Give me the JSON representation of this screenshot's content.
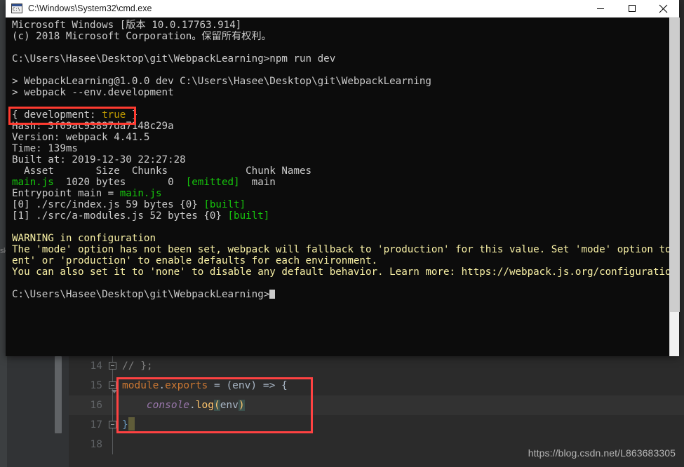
{
  "window": {
    "title": "C:\\Windows\\System32\\cmd.exe",
    "icon_name": "cmd-icon",
    "icon_text": "C:\\",
    "minimize_label": "Minimize",
    "maximize_label": "Maximize",
    "close_label": "Close"
  },
  "console": {
    "lines": [
      {
        "segments": [
          {
            "text": "Microsoft Windows [版本 10.0.17763.914]",
            "color": "white"
          }
        ]
      },
      {
        "segments": [
          {
            "text": "(c) 2018 Microsoft Corporation。保留所有权利。",
            "color": "white"
          }
        ]
      },
      {
        "segments": [
          {
            "text": "",
            "color": "white"
          }
        ]
      },
      {
        "segments": [
          {
            "text": "C:\\Users\\Hasee\\Desktop\\git\\WebpackLearning>npm run dev",
            "color": "white"
          }
        ]
      },
      {
        "segments": [
          {
            "text": "",
            "color": "white"
          }
        ]
      },
      {
        "segments": [
          {
            "text": "> WebpackLearning@1.0.0 dev C:\\Users\\Hasee\\Desktop\\git\\WebpackLearning",
            "color": "white"
          }
        ]
      },
      {
        "segments": [
          {
            "text": "> webpack --env.development",
            "color": "white"
          }
        ]
      },
      {
        "segments": [
          {
            "text": "",
            "color": "white"
          }
        ]
      },
      {
        "segments": [
          {
            "text": "{ development: ",
            "color": "white"
          },
          {
            "text": "true",
            "color": "yellow"
          },
          {
            "text": " }",
            "color": "white"
          }
        ]
      },
      {
        "segments": [
          {
            "text": "Hash: 3f09ac93897da7148c29a",
            "color": "white"
          }
        ]
      },
      {
        "segments": [
          {
            "text": "Version: webpack 4.41.5",
            "color": "white"
          }
        ]
      },
      {
        "segments": [
          {
            "text": "Time: 139ms",
            "color": "white"
          }
        ]
      },
      {
        "segments": [
          {
            "text": "Built at: 2019-12-30 22:27:28",
            "color": "white"
          }
        ]
      },
      {
        "segments": [
          {
            "text": "  Asset       Size  Chunks             Chunk Names",
            "color": "white"
          }
        ]
      },
      {
        "segments": [
          {
            "text": "main.js",
            "color": "green"
          },
          {
            "text": "  1020 bytes       0  ",
            "color": "white"
          },
          {
            "text": "[emitted]",
            "color": "green"
          },
          {
            "text": "  main",
            "color": "white"
          }
        ]
      },
      {
        "segments": [
          {
            "text": "Entrypoint main = ",
            "color": "white"
          },
          {
            "text": "main.js",
            "color": "green"
          }
        ]
      },
      {
        "segments": [
          {
            "text": "[0] ./src/index.js 59 bytes {0} ",
            "color": "white"
          },
          {
            "text": "[built]",
            "color": "green"
          }
        ]
      },
      {
        "segments": [
          {
            "text": "[1] ./src/a-modules.js 52 bytes {0} ",
            "color": "white"
          },
          {
            "text": "[built]",
            "color": "green"
          }
        ]
      },
      {
        "segments": [
          {
            "text": "",
            "color": "white"
          }
        ]
      },
      {
        "segments": [
          {
            "text": "WARNING in configuration",
            "color": "warn"
          }
        ]
      },
      {
        "segments": [
          {
            "text": "The 'mode' option has not been set, webpack will fallback to 'production' for this value. Set 'mode' option to 'developm",
            "color": "warn"
          }
        ]
      },
      {
        "segments": [
          {
            "text": "ent' or 'production' to enable defaults for each environment.",
            "color": "warn"
          }
        ]
      },
      {
        "segments": [
          {
            "text": "You can also set it to 'none' to disable any default behavior. Learn more: https://webpack.js.org/configuration/mode/",
            "color": "warn"
          }
        ]
      },
      {
        "segments": [
          {
            "text": "",
            "color": "white"
          }
        ]
      },
      {
        "segments": [
          {
            "text": "C:\\Users\\Hasee\\Desktop\\git\\WebpackLearning>",
            "color": "white",
            "cursor": true
          }
        ]
      }
    ]
  },
  "editor": {
    "lines": [
      {
        "number": "14",
        "fold": "box",
        "tokens": [
          {
            "text": "// };",
            "style": "comment"
          }
        ]
      },
      {
        "number": "15",
        "fold": "arrow",
        "tokens": [
          {
            "text": "module",
            "style": "orange"
          },
          {
            "text": ".",
            "style": "default"
          },
          {
            "text": "exports",
            "style": "orange"
          },
          {
            "text": " = ",
            "style": "default"
          },
          {
            "text": "(",
            "style": "default"
          },
          {
            "text": "env",
            "style": "default"
          },
          {
            "text": ") ",
            "style": "default"
          },
          {
            "text": "=>",
            "style": "default"
          },
          {
            "text": " {",
            "style": "default"
          }
        ]
      },
      {
        "number": "16",
        "fold": "none",
        "current": true,
        "tokens": [
          {
            "text": "    ",
            "style": "default"
          },
          {
            "text": "console",
            "style": "purple"
          },
          {
            "text": ".",
            "style": "default"
          },
          {
            "text": "log",
            "style": "yellow"
          },
          {
            "text": "(",
            "style": "brace-hl"
          },
          {
            "text": "env",
            "style": "default"
          },
          {
            "text": ")",
            "style": "brace-hl"
          }
        ]
      },
      {
        "number": "17",
        "fold": "box",
        "tokens": [
          {
            "text": "}",
            "style": "blue"
          },
          {
            "text": "",
            "style": "caret"
          }
        ]
      },
      {
        "number": "18",
        "fold": "none",
        "tokens": [
          {
            "text": "",
            "style": "default"
          }
        ]
      }
    ]
  },
  "annotations": {
    "console_highlight_label": "development true highlight",
    "code_highlight_label": "module exports highlight"
  },
  "watermark": {
    "text": "https://blog.csdn.net/L863683305"
  },
  "background": {
    "ghost_text": "sk"
  },
  "colors": {
    "accent_red": "#ff3b30",
    "console_bg": "#0c0c0c",
    "console_green": "#16c60c",
    "console_yellow": "#c19c00",
    "warn_yellow": "#f9f1a5",
    "editor_bg": "#2b2b2b"
  }
}
